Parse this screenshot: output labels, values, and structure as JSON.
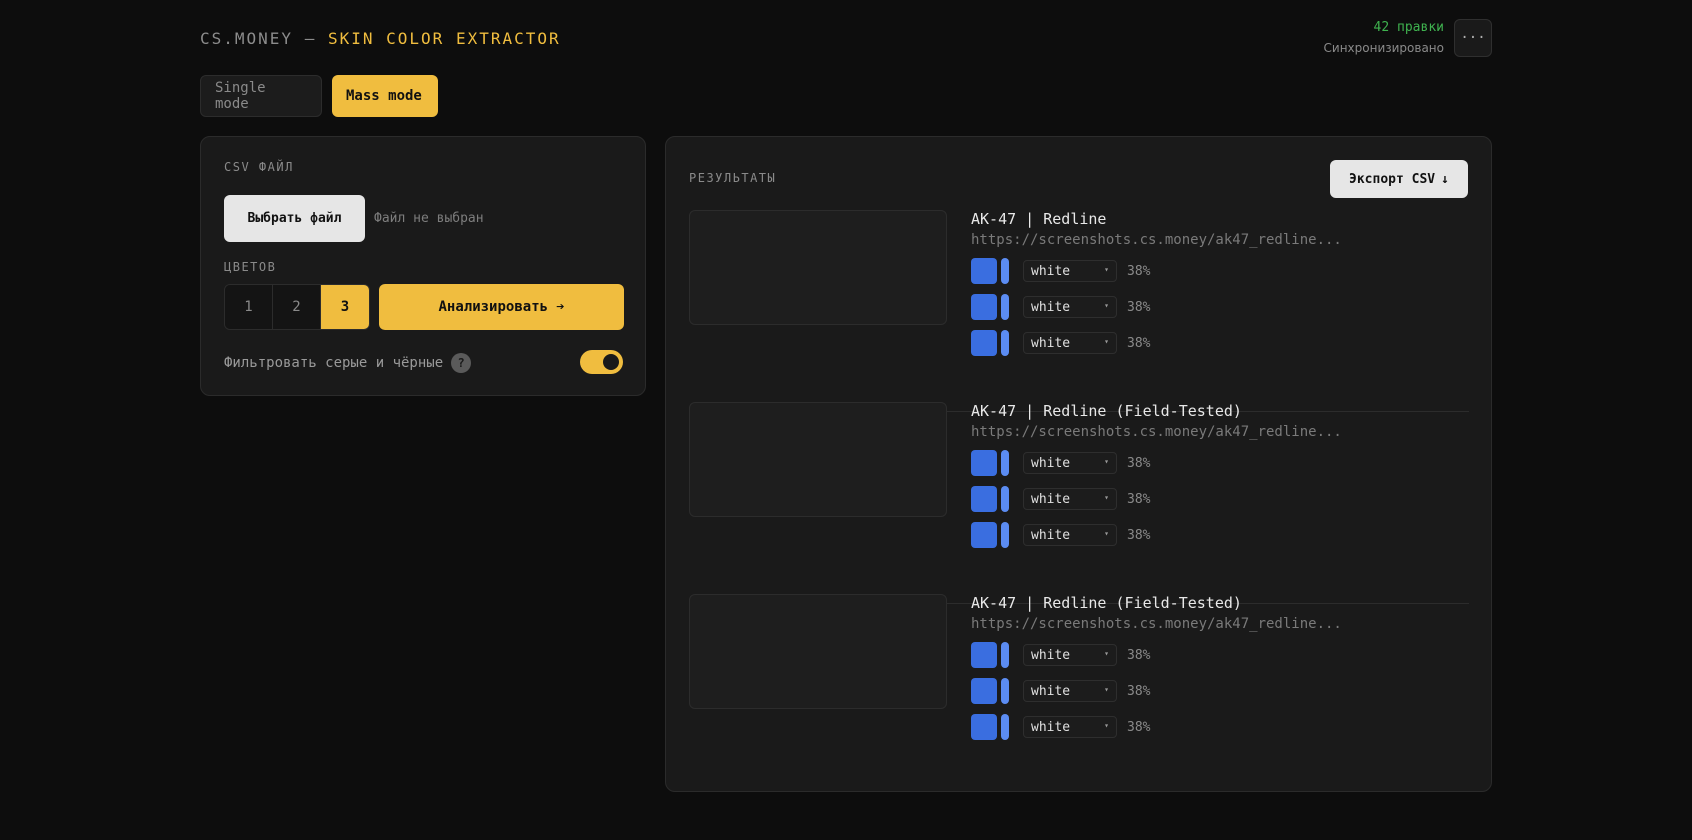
{
  "header": {
    "brand_left": "CS.MONEY",
    "brand_sep": "—",
    "brand_accent": "SKIN COLOR EXTRACTOR",
    "edits": "42 правки",
    "sync_status": "Синхронизировано",
    "more_label": "···"
  },
  "modes": [
    {
      "label": "Single mode",
      "active": false
    },
    {
      "label": "Mass mode",
      "active": true
    }
  ],
  "left": {
    "csv_label": "CSV ФАЙЛ",
    "file_button": "Выбрать файл",
    "file_name": "Файл не выбран",
    "colors_label": "ЦВЕТОВ",
    "color_counts": [
      "1",
      "2",
      "3"
    ],
    "selected_count": "3",
    "analyze_button": "Анализировать",
    "analyze_arrow": "➔",
    "filter_label": "Фильтровать серые и чёрные",
    "help_glyph": "?",
    "filter_enabled": true
  },
  "right": {
    "results_label": "РЕЗУЛЬТАТЫ",
    "export_button": "Экспорт CSV",
    "export_arrow": "↓"
  },
  "results": [
    {
      "name": "AK-47 | Redline",
      "url": "https://screenshots.cs.money/ak47_redline...",
      "colors": [
        {
          "label": "white",
          "percent": "38%",
          "swatch": "#3a6ee0",
          "bar": "#5b8cf2"
        },
        {
          "label": "white",
          "percent": "38%",
          "swatch": "#3a6ee0",
          "bar": "#5b8cf2"
        },
        {
          "label": "white",
          "percent": "38%",
          "swatch": "#3a6ee0",
          "bar": "#5b8cf2"
        }
      ]
    },
    {
      "name": "AK-47 | Redline (Field-Tested)",
      "url": "https://screenshots.cs.money/ak47_redline...",
      "colors": [
        {
          "label": "white",
          "percent": "38%",
          "swatch": "#3a6ee0",
          "bar": "#5b8cf2"
        },
        {
          "label": "white",
          "percent": "38%",
          "swatch": "#3a6ee0",
          "bar": "#5b8cf2"
        },
        {
          "label": "white",
          "percent": "38%",
          "swatch": "#3a6ee0",
          "bar": "#5b8cf2"
        }
      ]
    },
    {
      "name": "AK-47 | Redline (Field-Tested)",
      "url": "https://screenshots.cs.money/ak47_redline...",
      "colors": [
        {
          "label": "white",
          "percent": "38%",
          "swatch": "#3a6ee0",
          "bar": "#5b8cf2"
        },
        {
          "label": "white",
          "percent": "38%",
          "swatch": "#3a6ee0",
          "bar": "#5b8cf2"
        },
        {
          "label": "white",
          "percent": "38%",
          "swatch": "#3a6ee0",
          "bar": "#5b8cf2"
        }
      ]
    }
  ],
  "theme": {
    "accent": "#f0bd3f",
    "sync_green": "#3fb24f",
    "background": "#0d0d0d",
    "panel": "#1a1a1a"
  }
}
